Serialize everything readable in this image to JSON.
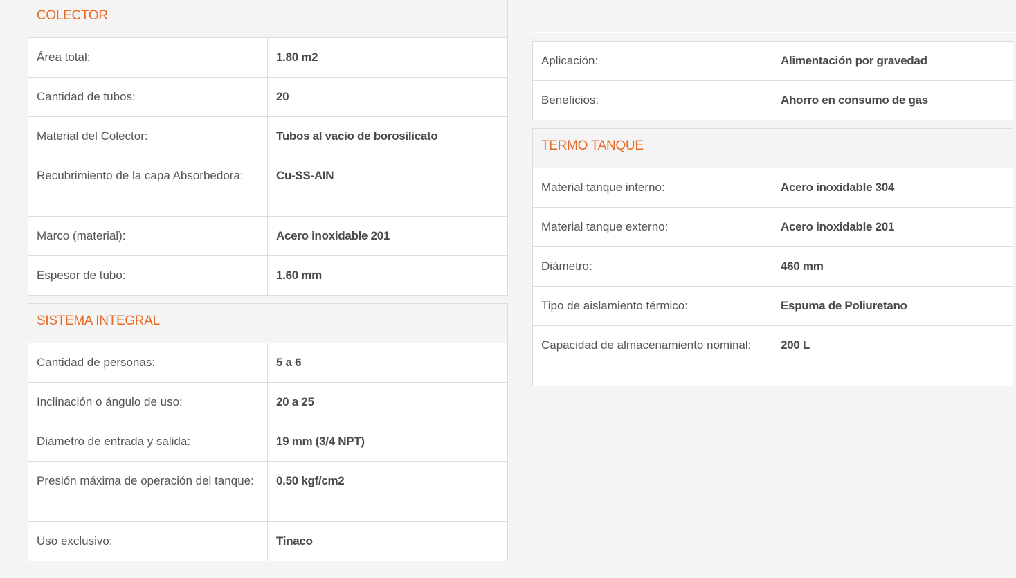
{
  "colector": {
    "title": "COLECTOR",
    "rows": [
      {
        "label": "Área total:",
        "value": "1.80 m2"
      },
      {
        "label": "Cantidad de tubos:",
        "value": "20"
      },
      {
        "label": "Material del Colector:",
        "value": "Tubos al vacio de borosilicato"
      },
      {
        "label": "Recubrimiento de la capa Absorbedora:",
        "value": "Cu-SS-AIN"
      },
      {
        "label": "Marco (material):",
        "value": "Acero inoxidable 201"
      },
      {
        "label": "Espesor de tubo:",
        "value": "1.60 mm"
      }
    ]
  },
  "sistema": {
    "title": "SISTEMA INTEGRAL",
    "rows": [
      {
        "label": "Cantidad de personas:",
        "value": "5 a 6"
      },
      {
        "label": "Inclinación o ángulo de uso:",
        "value": "20 a 25"
      },
      {
        "label": "Diámetro de entrada y salida:",
        "value": "19 mm (3/4 NPT)"
      },
      {
        "label": "Presión máxima de operación del tanque:",
        "value": "0.50 kgf/cm2"
      },
      {
        "label": "Uso exclusivo:",
        "value": "Tinaco"
      }
    ]
  },
  "general": {
    "rows": [
      {
        "label": "Aplicación:",
        "value": "Alimentación por gravedad"
      },
      {
        "label": "Beneficios:",
        "value": "Ahorro en consumo de gas"
      }
    ]
  },
  "termo": {
    "title": "TERMO TANQUE",
    "rows": [
      {
        "label": "Material tanque interno:",
        "value": "Acero inoxidable 304"
      },
      {
        "label": "Material tanque externo:",
        "value": "Acero inoxidable 201"
      },
      {
        "label": "Diámetro:",
        "value": "460 mm"
      },
      {
        "label": "Tipo de aislamiento térmico:",
        "value": "Espuma de Poliuretano"
      },
      {
        "label": "Capacidad de almacenamiento nominal:",
        "value": "200 L"
      }
    ]
  },
  "colors": {
    "accent": "#e86a22",
    "background": "#f4f4f4",
    "border": "#dcdcdc"
  }
}
